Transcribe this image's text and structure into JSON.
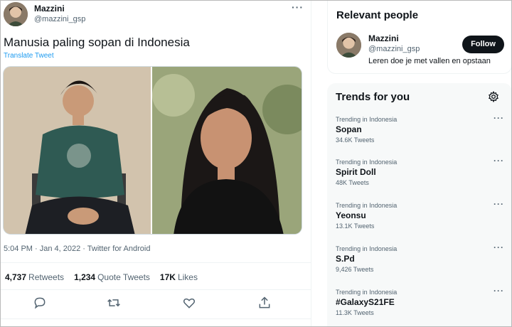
{
  "tweet": {
    "author_name": "Mazzini",
    "author_handle": "@mazzini_gsp",
    "more": "···",
    "text": "Manusia paling sopan di Indonesia",
    "translate": "Translate Tweet",
    "meta": "5:04 PM · Jan 4, 2022 · Twitter for Android",
    "stats": {
      "retweets_count": "4,737",
      "retweets_label": "Retweets",
      "quotes_count": "1,234",
      "quotes_label": "Quote Tweets",
      "likes_count": "17K",
      "likes_label": "Likes"
    },
    "actions": [
      "reply-icon",
      "retweet-icon",
      "like-icon",
      "share-icon"
    ]
  },
  "relevant": {
    "title": "Relevant people",
    "name": "Mazzini",
    "handle": "@mazzini_gsp",
    "bio": "Leren doe je met vallen en opstaan",
    "follow": "Follow"
  },
  "trends": {
    "title": "Trends for you",
    "items": [
      {
        "meta": "Trending in Indonesia",
        "name": "Sopan",
        "count": "34.6K Tweets",
        "more": "···"
      },
      {
        "meta": "Trending in Indonesia",
        "name": "Spirit Doll",
        "count": "48K Tweets",
        "more": "···"
      },
      {
        "meta": "Trending in Indonesia",
        "name": "Yeonsu",
        "count": "13.1K Tweets",
        "more": "···"
      },
      {
        "meta": "Trending in Indonesia",
        "name": "S.Pd",
        "count": "9,426 Tweets",
        "more": "···"
      },
      {
        "meta": "Trending in Indonesia",
        "name": "#GalaxyS21FE",
        "count": "11.3K Tweets",
        "more": "···"
      }
    ]
  },
  "colors": {
    "link": "#1d9bf0",
    "secondary_text": "#536471",
    "follow_bg": "#0f1419"
  }
}
